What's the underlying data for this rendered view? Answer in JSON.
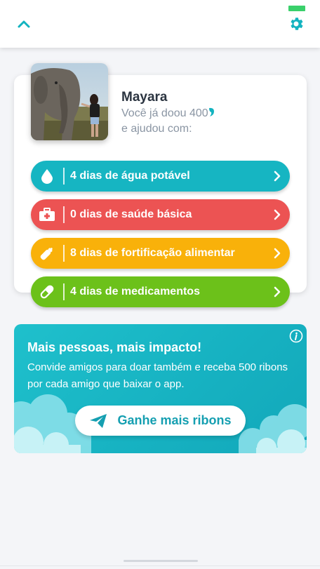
{
  "colors": {
    "accent": "#13b3c0",
    "water": "#16b5c2",
    "health": "#ec5353",
    "food": "#f9b10a",
    "medicine": "#6cc11a"
  },
  "header": {
    "back_icon": "chevron-up-icon",
    "settings_icon": "gear-icon"
  },
  "profile": {
    "name": "Mayara",
    "donated_text": "Você já doou 400",
    "helped_text": "e ajudou com:"
  },
  "impacts": [
    {
      "icon": "water-drop-icon",
      "label": "4 dias de água potável"
    },
    {
      "icon": "first-aid-kit-icon",
      "label": "0 dias de saúde básica"
    },
    {
      "icon": "baby-bottle-icon",
      "label": "8 dias de fortificação alimentar"
    },
    {
      "icon": "pill-icon",
      "label": "4 dias de medicamentos"
    }
  ],
  "promo": {
    "title": "Mais pessoas, mais impacto!",
    "text": "Convide amigos para doar também e receba 500 ribons por cada amigo que baixar o app.",
    "cta_label": "Ganhe mais ribons",
    "cta_icon": "paper-plane-icon",
    "info_icon": "info-icon"
  }
}
